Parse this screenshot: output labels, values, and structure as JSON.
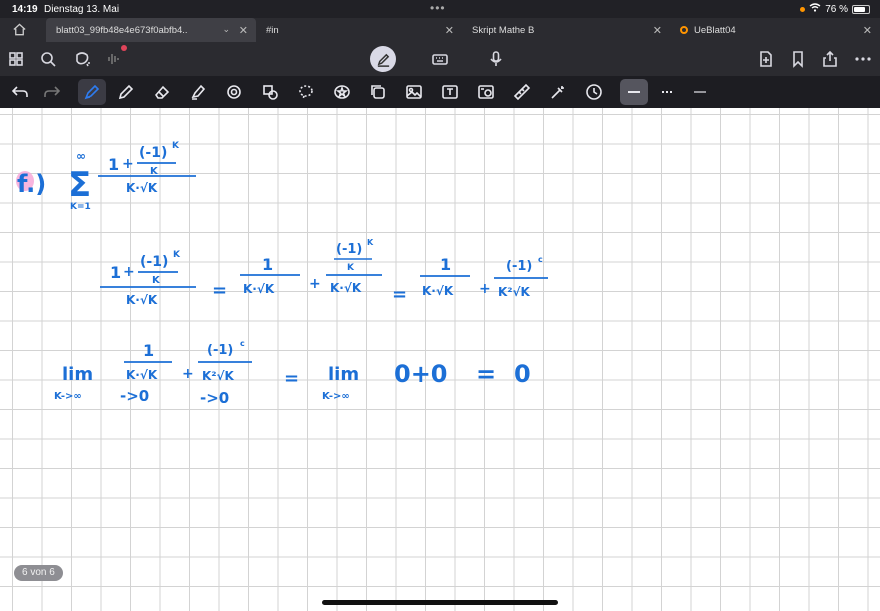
{
  "status": {
    "time": "14:19",
    "date": "Dienstag 13. Mai",
    "battery": "76 %"
  },
  "tabs": [
    {
      "label": "blatt03_99fb48e4e673f0abfb4..",
      "active": true
    },
    {
      "label": "#in"
    },
    {
      "label": "Skript Mathe B"
    },
    {
      "label": "UeBlatt04"
    }
  ],
  "colors": {
    "ink": "#1c6fd6",
    "highlight": "#f7a8d8",
    "swatch_blue_1": "#1a6fe0",
    "swatch_blue_2": "#1558c0",
    "swatch_black": "#000000"
  },
  "notes": {
    "label_f": "f.)",
    "sum_top": "∞",
    "sum_bottom": "K=1",
    "one": "1",
    "plus": "+",
    "neg_one_k": "(-1)",
    "exp_k": "K",
    "exp_c": "c",
    "k": "K",
    "k_sqrt_k": "K·√K",
    "k2_sqrt_k": "K²√K",
    "equals": "=",
    "lim": "lim",
    "lim_sub": "K->∞",
    "arrow_zero": "->0",
    "zero_sum": "0+0",
    "zero": "0"
  },
  "page_indicator": "6 von 6"
}
